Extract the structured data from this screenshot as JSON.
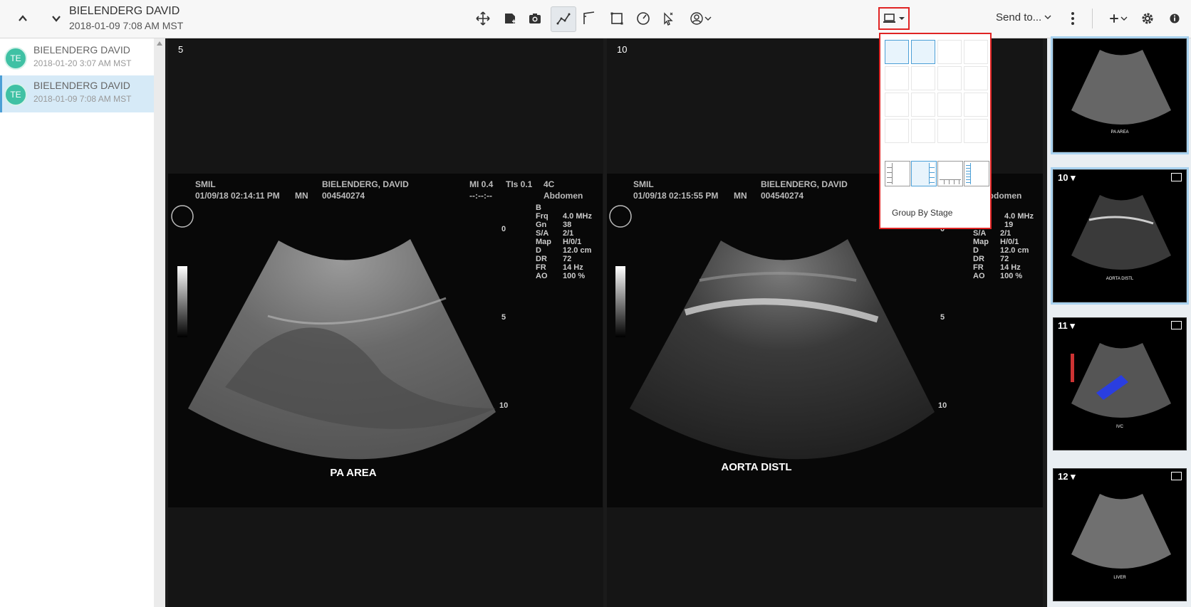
{
  "header": {
    "patient_name": "BIELENDERG DAVID",
    "study_date": "2018-01-09 7:08 AM MST",
    "send_to_label": "Send to..."
  },
  "icons": {
    "prev_study": "chevron-up-icon",
    "next_study": "chevron-down-icon",
    "pan": "move-icon",
    "annotate": "annotate-icon",
    "snapshot": "camera-icon",
    "polyline": "polyline-icon",
    "angle": "angle-icon",
    "rectangle": "rectangle-icon",
    "ellipse": "gauge-icon",
    "pointer": "pointer-icon",
    "user_tool": "user-tool-icon",
    "layout": "monitor-icon",
    "more": "vertical-dots-icon",
    "add": "plus-icon",
    "settings": "gear-icon",
    "info": "info-icon"
  },
  "sidebar": {
    "studies": [
      {
        "initials": "TE",
        "name": "BIELENDERG DAVID",
        "date": "2018-01-20 3:07 AM MST",
        "selected": false
      },
      {
        "initials": "TE",
        "name": "BIELENDERG DAVID",
        "date": "2018-01-09 7:08 AM MST",
        "selected": true
      }
    ]
  },
  "viewports": [
    {
      "number": "5",
      "site": "SMIL",
      "datetime": "01/09/18 02:14:11 PM",
      "operator": "MN",
      "patient": "BIELENDERG, DAVID",
      "patient_id": "004540274",
      "mi": "MI 0.4",
      "tis": "TIs 0.1",
      "probe": "4C",
      "dash": "--:--:--",
      "exam": "Abdomen",
      "params": [
        {
          "k": "B",
          "v": ""
        },
        {
          "k": "Frq",
          "v": "4.0 MHz"
        },
        {
          "k": "Gn",
          "v": "38"
        },
        {
          "k": "S/A",
          "v": "2/1"
        },
        {
          "k": "Map",
          "v": "H/0/1"
        },
        {
          "k": "D",
          "v": "12.0 cm"
        },
        {
          "k": "DR",
          "v": "72"
        },
        {
          "k": "FR",
          "v": "14 Hz"
        },
        {
          "k": "AO",
          "v": "100 %"
        }
      ],
      "depth_labels": [
        "0",
        "5",
        "10"
      ],
      "caption": "PA AREA"
    },
    {
      "number": "10",
      "site": "SMIL",
      "datetime": "01/09/18 02:15:55 PM",
      "operator": "MN",
      "patient": "BIELENDERG, DAVID",
      "patient_id": "004540274",
      "exam": "Abdomen",
      "params": [
        {
          "k": "",
          "v": "4.0 MHz"
        },
        {
          "k": "",
          "v": "19"
        },
        {
          "k": "S/A",
          "v": "2/1"
        },
        {
          "k": "Map",
          "v": "H/0/1"
        },
        {
          "k": "D",
          "v": "12.0 cm"
        },
        {
          "k": "DR",
          "v": "72"
        },
        {
          "k": "FR",
          "v": "14 Hz"
        },
        {
          "k": "AO",
          "v": "100 %"
        }
      ],
      "depth_labels": [
        "0",
        "5",
        "10"
      ],
      "caption": "AORTA DISTL"
    }
  ],
  "layout_popup": {
    "grid_rows": 4,
    "grid_cols": 4,
    "selected_cells": [
      [
        0,
        0
      ],
      [
        0,
        1
      ]
    ],
    "presets": [
      "stack-left",
      "stack-right",
      "strip-bottom",
      "stack-right-narrow"
    ],
    "selected_preset": 1,
    "group_by_stage_label": "Group By Stage"
  },
  "thumbnails": [
    {
      "number": "",
      "caption": "PA AREA",
      "selected": true
    },
    {
      "number": "10",
      "caption": "AORTA DISTL",
      "selected": true
    },
    {
      "number": "11",
      "caption": "IVC",
      "selected": false
    },
    {
      "number": "12",
      "caption": "LIVER",
      "selected": false
    }
  ]
}
